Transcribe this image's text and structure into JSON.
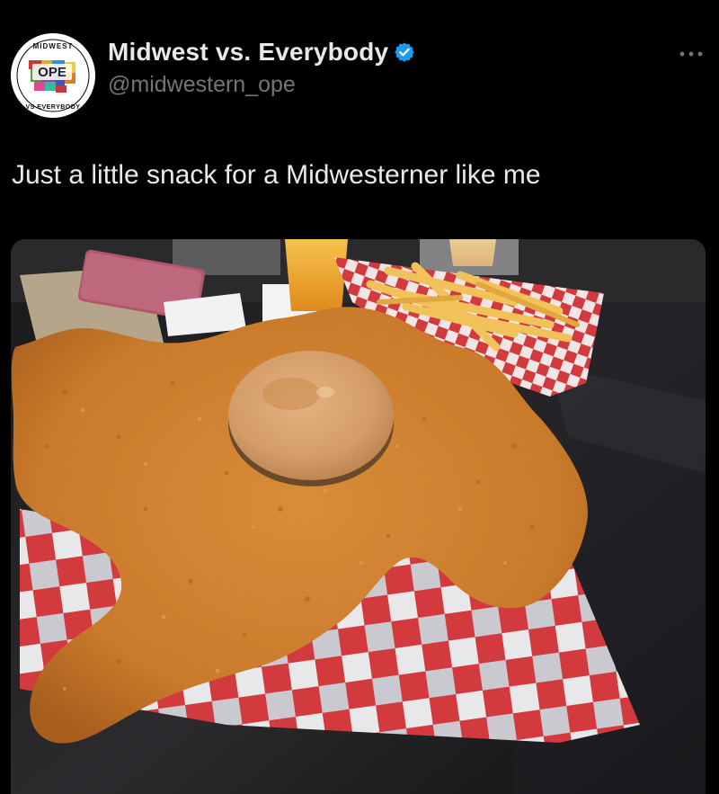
{
  "author": {
    "display_name": "Midwest vs. Everybody",
    "handle": "@midwestern_ope",
    "verified": true,
    "avatar": {
      "top_text": "MIDWEST",
      "center_text": "OPE",
      "bottom_text": "VS EVERYBODY"
    }
  },
  "post": {
    "text": "Just a little snack for a Midwesterner like me",
    "media_description": "giant-breaded-tenderloin-sandwich-photo"
  },
  "menu_icon": "more-dots-icon",
  "colors": {
    "background": "#000000",
    "text": "#e7e9ea",
    "secondary_text": "#71767b",
    "verified_badge": "#1d9bf0"
  }
}
